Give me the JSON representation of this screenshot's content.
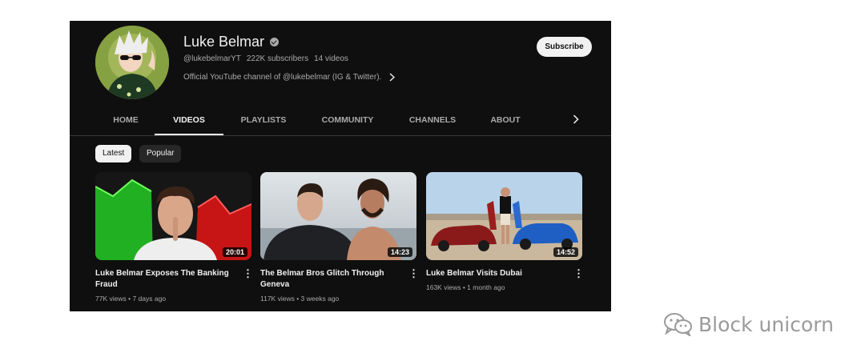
{
  "channel": {
    "name": "Luke Belmar",
    "handle": "@lukebelmarYT",
    "subscribers": "222K subscribers",
    "video_count": "14 videos",
    "description": "Official YouTube channel of @lukebelmar (IG & Twitter).",
    "subscribe_label": "Subscribe"
  },
  "tabs": [
    {
      "label": "HOME",
      "active": false
    },
    {
      "label": "VIDEOS",
      "active": true
    },
    {
      "label": "PLAYLISTS",
      "active": false
    },
    {
      "label": "COMMUNITY",
      "active": false
    },
    {
      "label": "CHANNELS",
      "active": false
    },
    {
      "label": "ABOUT",
      "active": false
    }
  ],
  "filters": [
    {
      "label": "Latest",
      "selected": true
    },
    {
      "label": "Popular",
      "selected": false
    }
  ],
  "videos": [
    {
      "title": "Luke Belmar Exposes The Banking Fraud",
      "views": "77K views",
      "age": "7 days ago",
      "duration": "20:01"
    },
    {
      "title": "The Belmar Bros Glitch Through Geneva",
      "views": "117K views",
      "age": "3 weeks ago",
      "duration": "14:23"
    },
    {
      "title": "Luke Belmar Visits Dubai",
      "views": "163K views",
      "age": "1 month ago",
      "duration": "14:52"
    }
  ],
  "watermark": "Block unicorn",
  "icons": {
    "verified": "verified-check-icon",
    "description_more": "chevron-right-icon",
    "tabs_scroll": "chevron-right-icon",
    "video_menu": "more-vert-icon",
    "watermark": "wechat-icon"
  },
  "colors": {
    "background": "#0f0f0f",
    "text_primary": "#f1f1f1",
    "text_secondary": "#aaaaaa",
    "chip_inactive": "#272727"
  }
}
